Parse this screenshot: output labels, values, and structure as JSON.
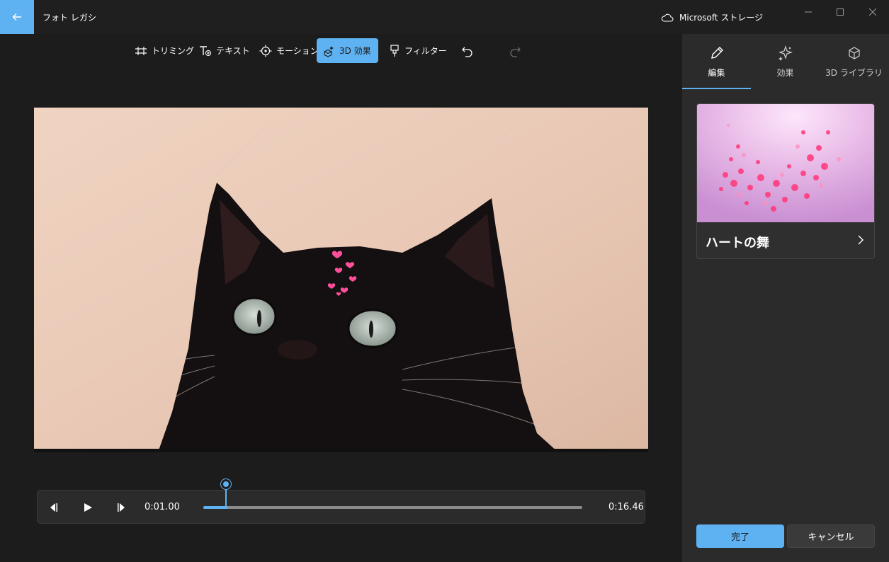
{
  "app": {
    "title": "フォト レガシ",
    "storage_label": "Microsoft ストレージ"
  },
  "toolbar": {
    "trim": "トリミング",
    "text": "テキスト",
    "motion": "モーション",
    "effects3d": "3D 効果",
    "filter": "フィルター"
  },
  "playback": {
    "current_time": "0:01.00",
    "total_time": "0:16.46",
    "progress": 0.063
  },
  "panel": {
    "tabs": [
      {
        "label": "編集",
        "icon": "pencil-icon"
      },
      {
        "label": "効果",
        "icon": "sparkle-icon"
      },
      {
        "label": "3D ライブラリ",
        "icon": "cube-icon"
      }
    ],
    "effect_card": {
      "label": "ハートの舞"
    },
    "done": "完了",
    "cancel": "キャンセル"
  },
  "colors": {
    "accent": "#5fb2f2",
    "background": "#1c1c1c",
    "panel": "#2b2b2b"
  }
}
